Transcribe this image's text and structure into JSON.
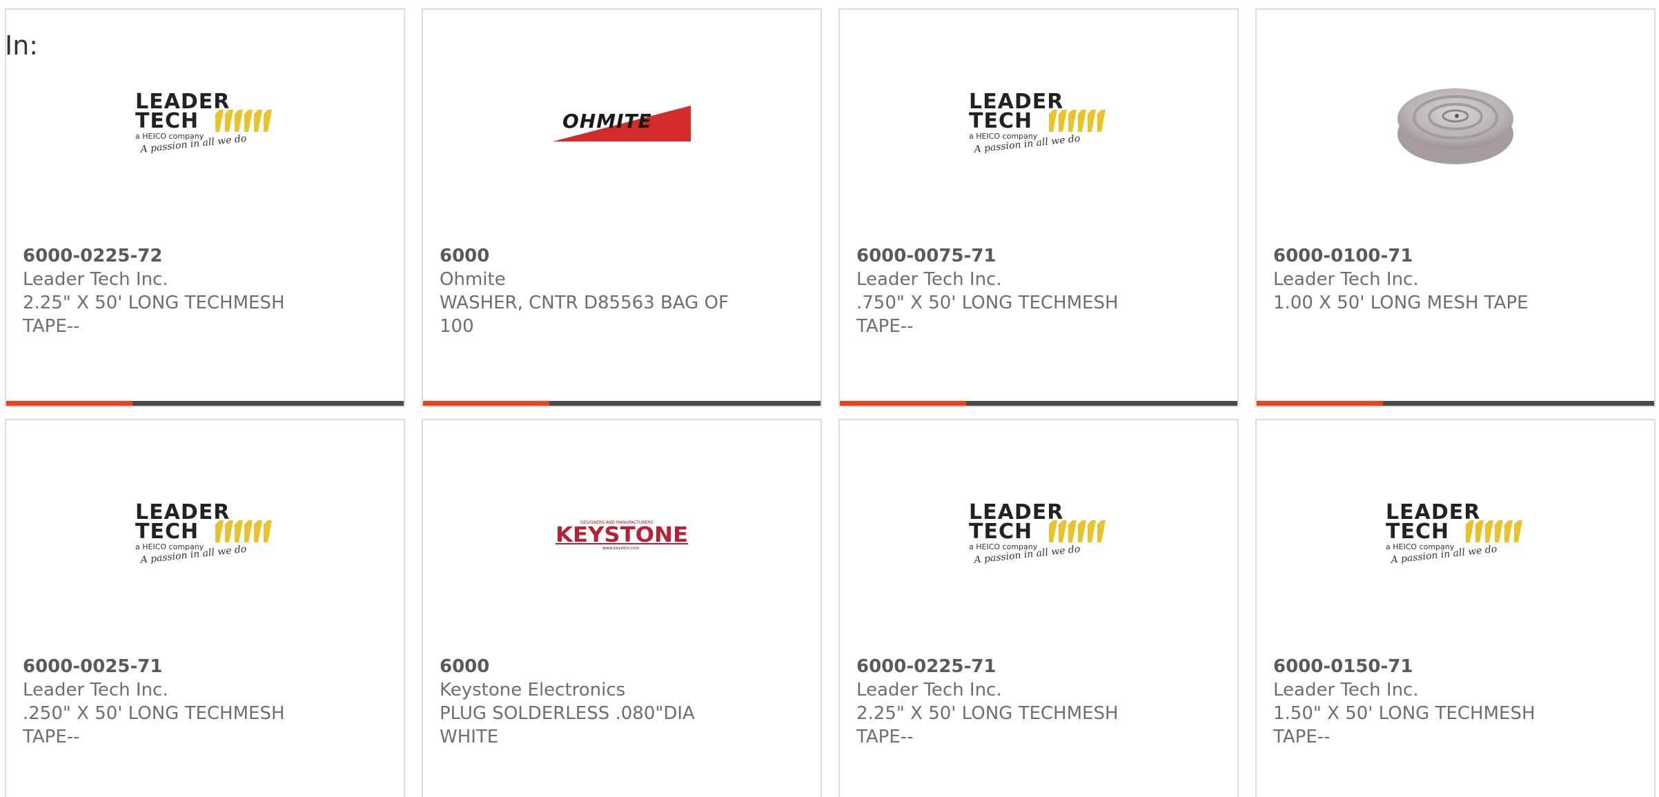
{
  "filter": {
    "label": "In:"
  },
  "colors": {
    "accent": "#e8431a",
    "bar_dark": "#4a4a4a",
    "card_border": "#dcdcdc",
    "text": "#6e6e6e"
  },
  "products": [
    {
      "part_number": "6000-0225-72",
      "manufacturer": "Leader Tech Inc.",
      "description": "2.25\" X 50' LONG TECHMESH TAPE--",
      "image": "leader-tech-logo"
    },
    {
      "part_number": "6000",
      "manufacturer": "Ohmite",
      "description": "WASHER, CNTR D85563 BAG OF 100",
      "image": "ohmite-logo"
    },
    {
      "part_number": "6000-0075-71",
      "manufacturer": "Leader Tech Inc.",
      "description": ".750\" X 50' LONG TECHMESH TAPE--",
      "image": "leader-tech-logo"
    },
    {
      "part_number": "6000-0100-71",
      "manufacturer": "Leader Tech Inc.",
      "description": "1.00 X 50' LONG MESH TAPE",
      "image": "mesh-tape-roll-photo"
    },
    {
      "part_number": "6000-0025-71",
      "manufacturer": "Leader Tech Inc.",
      "description": ".250\" X 50' LONG TECHMESH TAPE--",
      "image": "leader-tech-logo"
    },
    {
      "part_number": "6000",
      "manufacturer": "Keystone Electronics",
      "description": "PLUG SOLDERLESS .080\"DIA WHITE",
      "image": "keystone-logo"
    },
    {
      "part_number": "6000-0225-71",
      "manufacturer": "Leader Tech Inc.",
      "description": "2.25\" X 50' LONG TECHMESH TAPE--",
      "image": "leader-tech-logo"
    },
    {
      "part_number": "6000-0150-71",
      "manufacturer": "Leader Tech Inc.",
      "description": "1.50\" X 50' LONG TECHMESH TAPE--",
      "image": "leader-tech-logo"
    }
  ]
}
